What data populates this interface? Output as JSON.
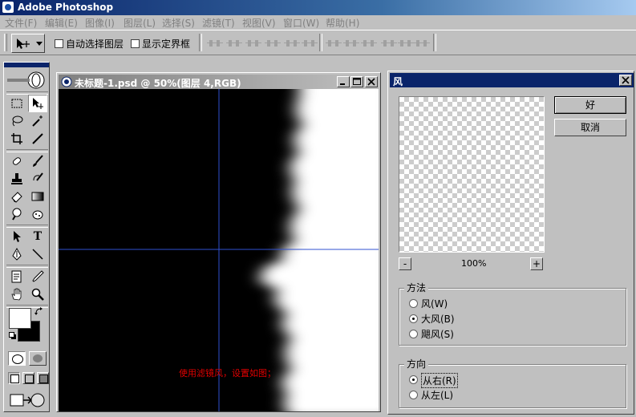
{
  "app": {
    "title": "Adobe Photoshop"
  },
  "menu": {
    "items": [
      "文件(F)",
      "编辑(E)",
      "图像(I)",
      "图层(L)",
      "选择(S)",
      "滤镜(T)",
      "视图(V)",
      "窗口(W)",
      "帮助(H)"
    ]
  },
  "options": {
    "auto_select_label": "自动选择图层",
    "show_bounds_label": "显示定界框"
  },
  "document": {
    "title": "未标题-1.psd @ 50%(图层 4,RGB)",
    "caption": "使用滤镜风，设置如图；"
  },
  "dialog": {
    "title": "风",
    "ok_label": "好",
    "cancel_label": "取消",
    "zoom_level": "100%",
    "zoom_out_label": "-",
    "zoom_in_label": "+",
    "method": {
      "legend": "方法",
      "options": [
        "风(W)",
        "大风(B)",
        "飓风(S)"
      ],
      "selected": "大风(B)"
    },
    "direction": {
      "legend": "方向",
      "options": [
        "从右(R)",
        "从左(L)"
      ],
      "selected": "从右(R)"
    }
  },
  "colors": {
    "title_bar": "#0a246a",
    "guide_line": "#3050d0",
    "caption": "#e00000"
  }
}
